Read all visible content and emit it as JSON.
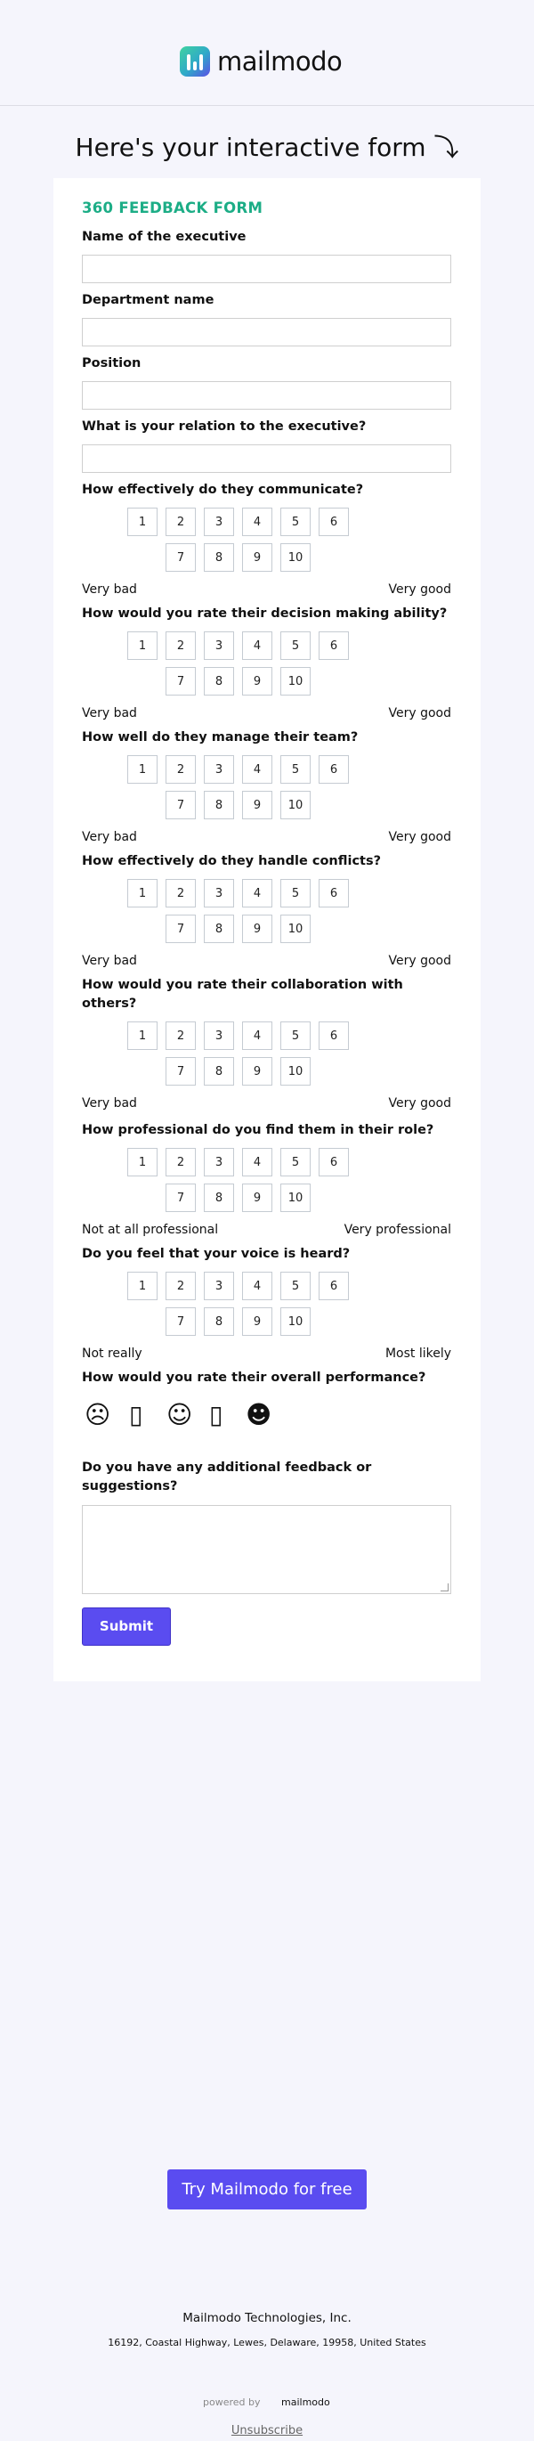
{
  "brand": {
    "name": "mailmodo"
  },
  "hero": {
    "text": "Here's your interactive form ⤵"
  },
  "form": {
    "title": "360 FEEDBACK FORM",
    "text_fields": [
      "Name of the executive",
      "Department name",
      "Position",
      "What is your relation to the executive?"
    ],
    "scale_numbers": [
      "1",
      "2",
      "3",
      "4",
      "5",
      "6",
      "7",
      "8",
      "9",
      "10"
    ],
    "rating_questions": [
      {
        "question": "How effectively do they communicate?",
        "low": "Very bad",
        "high": "Very good"
      },
      {
        "question": "How would you rate their decision making ability?",
        "low": "Very bad",
        "high": "Very good"
      },
      {
        "question": "How well do they manage their team?",
        "low": "Very bad",
        "high": "Very good"
      },
      {
        "question": "How effectively do they handle conflicts?",
        "low": "Very bad",
        "high": "Very good"
      },
      {
        "question": "How would you rate their collaboration with others?",
        "low": "Very bad",
        "high": "Very good"
      },
      {
        "question": "How professional do you find them in their role?",
        "low": "Not at all professional",
        "high": "Very professional"
      },
      {
        "question": "Do you feel that your voice is heard?",
        "low": "Not really",
        "high": "Most likely"
      }
    ],
    "emoji_question": "How would you rate their overall performance?",
    "emojis": [
      {
        "glyph": "☹",
        "name": "sad-face-icon"
      },
      {
        "glyph": "▯",
        "name": "neutral-sad-face-icon"
      },
      {
        "glyph": "☺",
        "name": "neutral-face-icon"
      },
      {
        "glyph": "▯",
        "name": "smile-face-icon"
      },
      {
        "glyph": "☻",
        "name": "love-face-icon"
      }
    ],
    "feedback_question": "Do you have any additional feedback or suggestions?",
    "submit_label": "Submit"
  },
  "cta": {
    "label": "Try Mailmodo for free"
  },
  "footer": {
    "company": "Mailmodo Technologies, Inc.",
    "address": "16192, Coastal Highway, Lewes, Delaware, 19958, United States",
    "powered_by": "powered by",
    "powered_brand": "mailmodo",
    "unsubscribe": "Unsubscribe"
  }
}
